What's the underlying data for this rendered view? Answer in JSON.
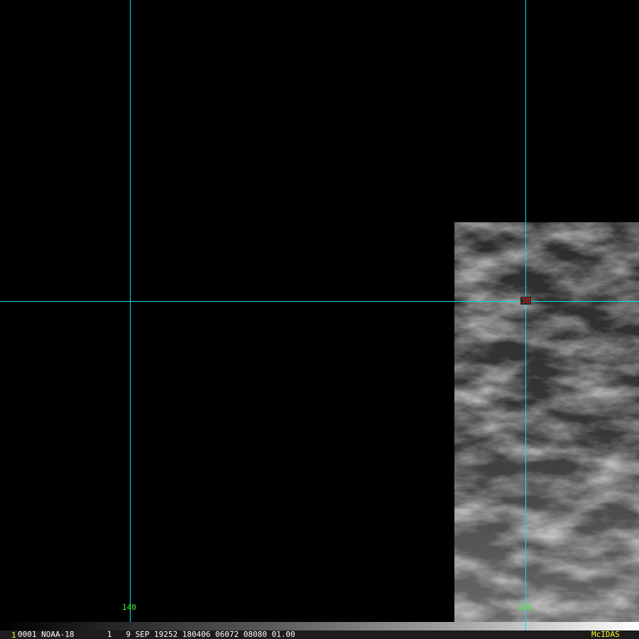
{
  "grid": {
    "color": "#00e5e5",
    "lon_labels": [
      "140",
      "135"
    ],
    "lat_labels": [
      "30"
    ],
    "lon_label_color": "#33ff33",
    "lat_label_color": "#ff2020"
  },
  "caption": {
    "frame_number": "1",
    "text": "0001 NOAA-18       1   9 SEP 19252 180406 06072 08080 01.00",
    "brand": "McIDAS"
  }
}
